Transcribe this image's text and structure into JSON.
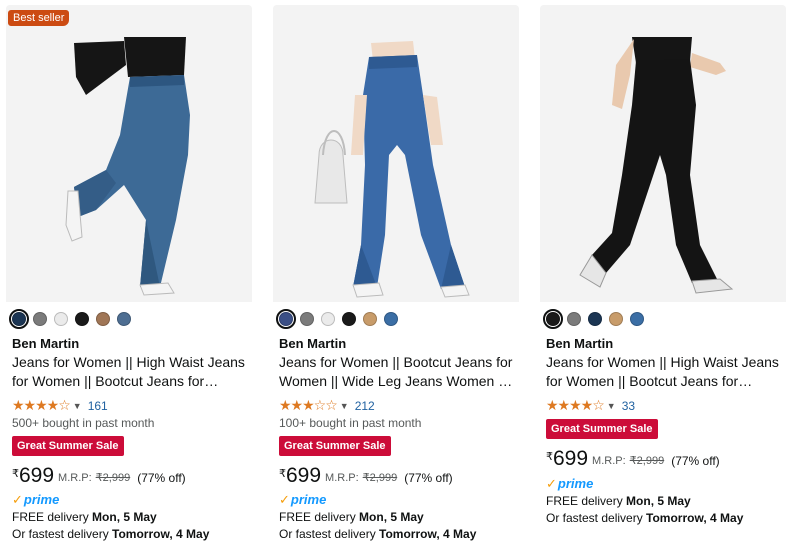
{
  "currency_symbol": "₹",
  "mrp_label": "M.R.P:",
  "products": [
    {
      "badge": "Best seller",
      "swatches": [
        "#1b3553",
        "#7b7b7b",
        "#ebebeb",
        "#1a1a1a",
        "#a07656",
        "#4e6e92"
      ],
      "selected_swatch": 0,
      "brand": "Ben Martin",
      "title": "Jeans for Women || High Waist Jeans for Women || Bootcut Jeans for Women ||...",
      "stars": "★★★★☆",
      "rating_count": "161",
      "bought": "500+ bought in past month",
      "sale_badge": "Great Summer Sale",
      "price": "699",
      "mrp": "₹2,999",
      "off": "(77% off)",
      "prime": "prime",
      "delivery_prefix": "FREE delivery ",
      "delivery_date": "Mon, 5 May",
      "fastest_prefix": "Or fastest delivery ",
      "fastest_date": "Tomorrow, 4 May"
    },
    {
      "swatches": [
        "#3b4f86",
        "#7b7b7b",
        "#ebebeb",
        "#1a1a1a",
        "#c89c6a",
        "#3b6ea5"
      ],
      "selected_swatch": 0,
      "brand": "Ben Martin",
      "title": "Jeans for Women || Bootcut Jeans for Women || Wide Leg Jeans Women || Be...",
      "stars": "★★★☆☆",
      "rating_count": "212",
      "bought": "100+ bought in past month",
      "sale_badge": "Great Summer Sale",
      "price": "699",
      "mrp": "₹2,999",
      "off": "(77% off)",
      "prime": "prime",
      "delivery_prefix": "FREE delivery ",
      "delivery_date": "Mon, 5 May",
      "fastest_prefix": "Or fastest delivery ",
      "fastest_date": "Tomorrow, 4 May"
    },
    {
      "swatches": [
        "#1a1a1a",
        "#7b7b7b",
        "#1b3553",
        "#c89c6a",
        "#3b6ea5"
      ],
      "selected_swatch": 0,
      "brand": "Ben Martin",
      "title": "Jeans for Women || High Waist Jeans for Women || Bootcut Jeans for Women ||...",
      "stars": "★★★★☆",
      "rating_count": "33",
      "sale_badge": "Great Summer Sale",
      "price": "699",
      "mrp": "₹2,999",
      "off": "(77% off)",
      "prime": "prime",
      "delivery_prefix": "FREE delivery ",
      "delivery_date": "Mon, 5 May",
      "fastest_prefix": "Or fastest delivery ",
      "fastest_date": "Tomorrow, 4 May"
    }
  ]
}
